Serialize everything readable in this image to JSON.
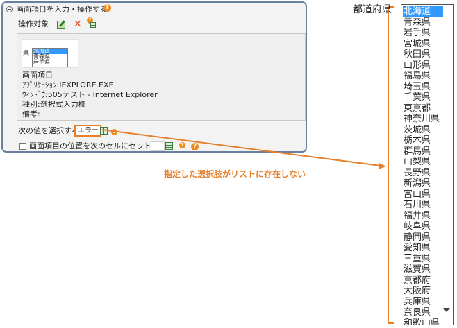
{
  "panel": {
    "title": "画面項目を入力・操作する",
    "target_label": "操作対象",
    "thumbnail": {
      "label": "県",
      "items": [
        "北海道",
        "青森県",
        "岩手県"
      ],
      "selected": 0
    },
    "details": {
      "heading": "画面項目",
      "application": "ｱﾌﾟﾘｹｰｼｮﾝ:IEXPLORE.EXE",
      "window": "ｳｨﾝﾄﾞｳ:505テスト - Internet Explorer",
      "kind": "種別:選択式入力欄",
      "note": "備考:"
    },
    "select_next_label": "次の値を選択する",
    "select_value": "エラー",
    "set_position_label": "画面項目の位置を次のセルにセットする"
  },
  "callout": {
    "text": "指定した選択肢がリストに存在しない",
    "color": "#e8802b"
  },
  "prefecture_list": {
    "label": "都道府県",
    "selected": 0,
    "items": [
      "北海道",
      "青森県",
      "岩手県",
      "宮城県",
      "秋田県",
      "山形県",
      "福島県",
      "埼玉県",
      "千葉県",
      "東京都",
      "神奈川県",
      "茨城県",
      "栃木県",
      "群馬県",
      "山梨県",
      "長野県",
      "新潟県",
      "富山県",
      "石川県",
      "福井県",
      "岐阜県",
      "静岡県",
      "愛知県",
      "三重県",
      "滋賀県",
      "京都府",
      "大阪府",
      "兵庫県",
      "奈良県",
      "和歌山県"
    ]
  },
  "icons": {
    "collapse": "collapse-minus-icon",
    "help": "help-question-icon",
    "edit": "edit-target-icon",
    "delete": "delete-x-icon",
    "grid": "grid-cell-icon"
  }
}
